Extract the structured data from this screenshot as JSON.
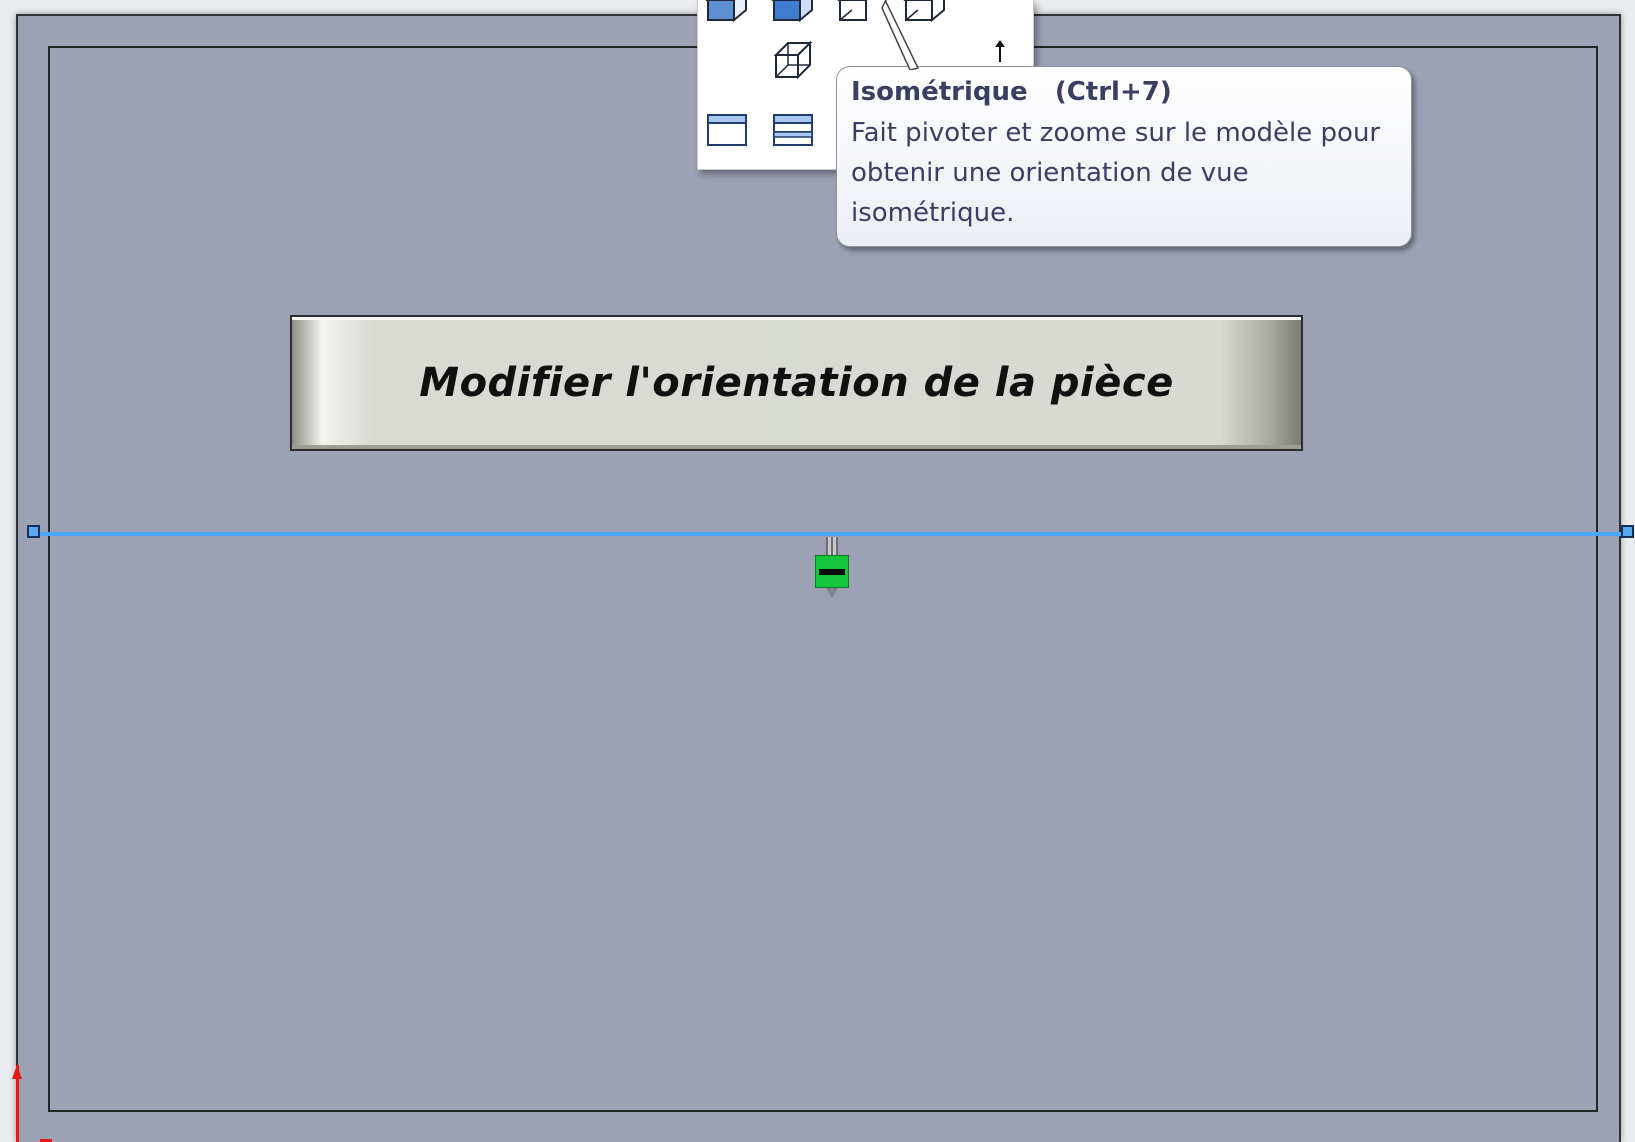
{
  "title_banner": {
    "text": "Modifier l'orientation de la pièce"
  },
  "tooltip": {
    "title": "Isométrique",
    "shortcut": "(Ctrl+7)",
    "description": "Fait pivoter et zoome sur le modèle pour obtenir une orientation de vue isométrique."
  },
  "view_flyout": {
    "buttons": [
      {
        "name": "front-view-icon"
      },
      {
        "name": "top-view-icon"
      },
      {
        "name": "trimetric-view-icon"
      },
      {
        "name": "dimetric-view-icon"
      },
      {
        "name": "isometric-view-icon"
      },
      {
        "name": "single-viewport-icon"
      },
      {
        "name": "two-viewport-icon"
      }
    ]
  },
  "colors": {
    "sheet_background": "#9ca1b3",
    "sketch_line": "#4aa7ff",
    "relation_marker": "#17c53c",
    "origin_axis": "#e11a1a",
    "tooltip_text": "#3b3e63"
  }
}
